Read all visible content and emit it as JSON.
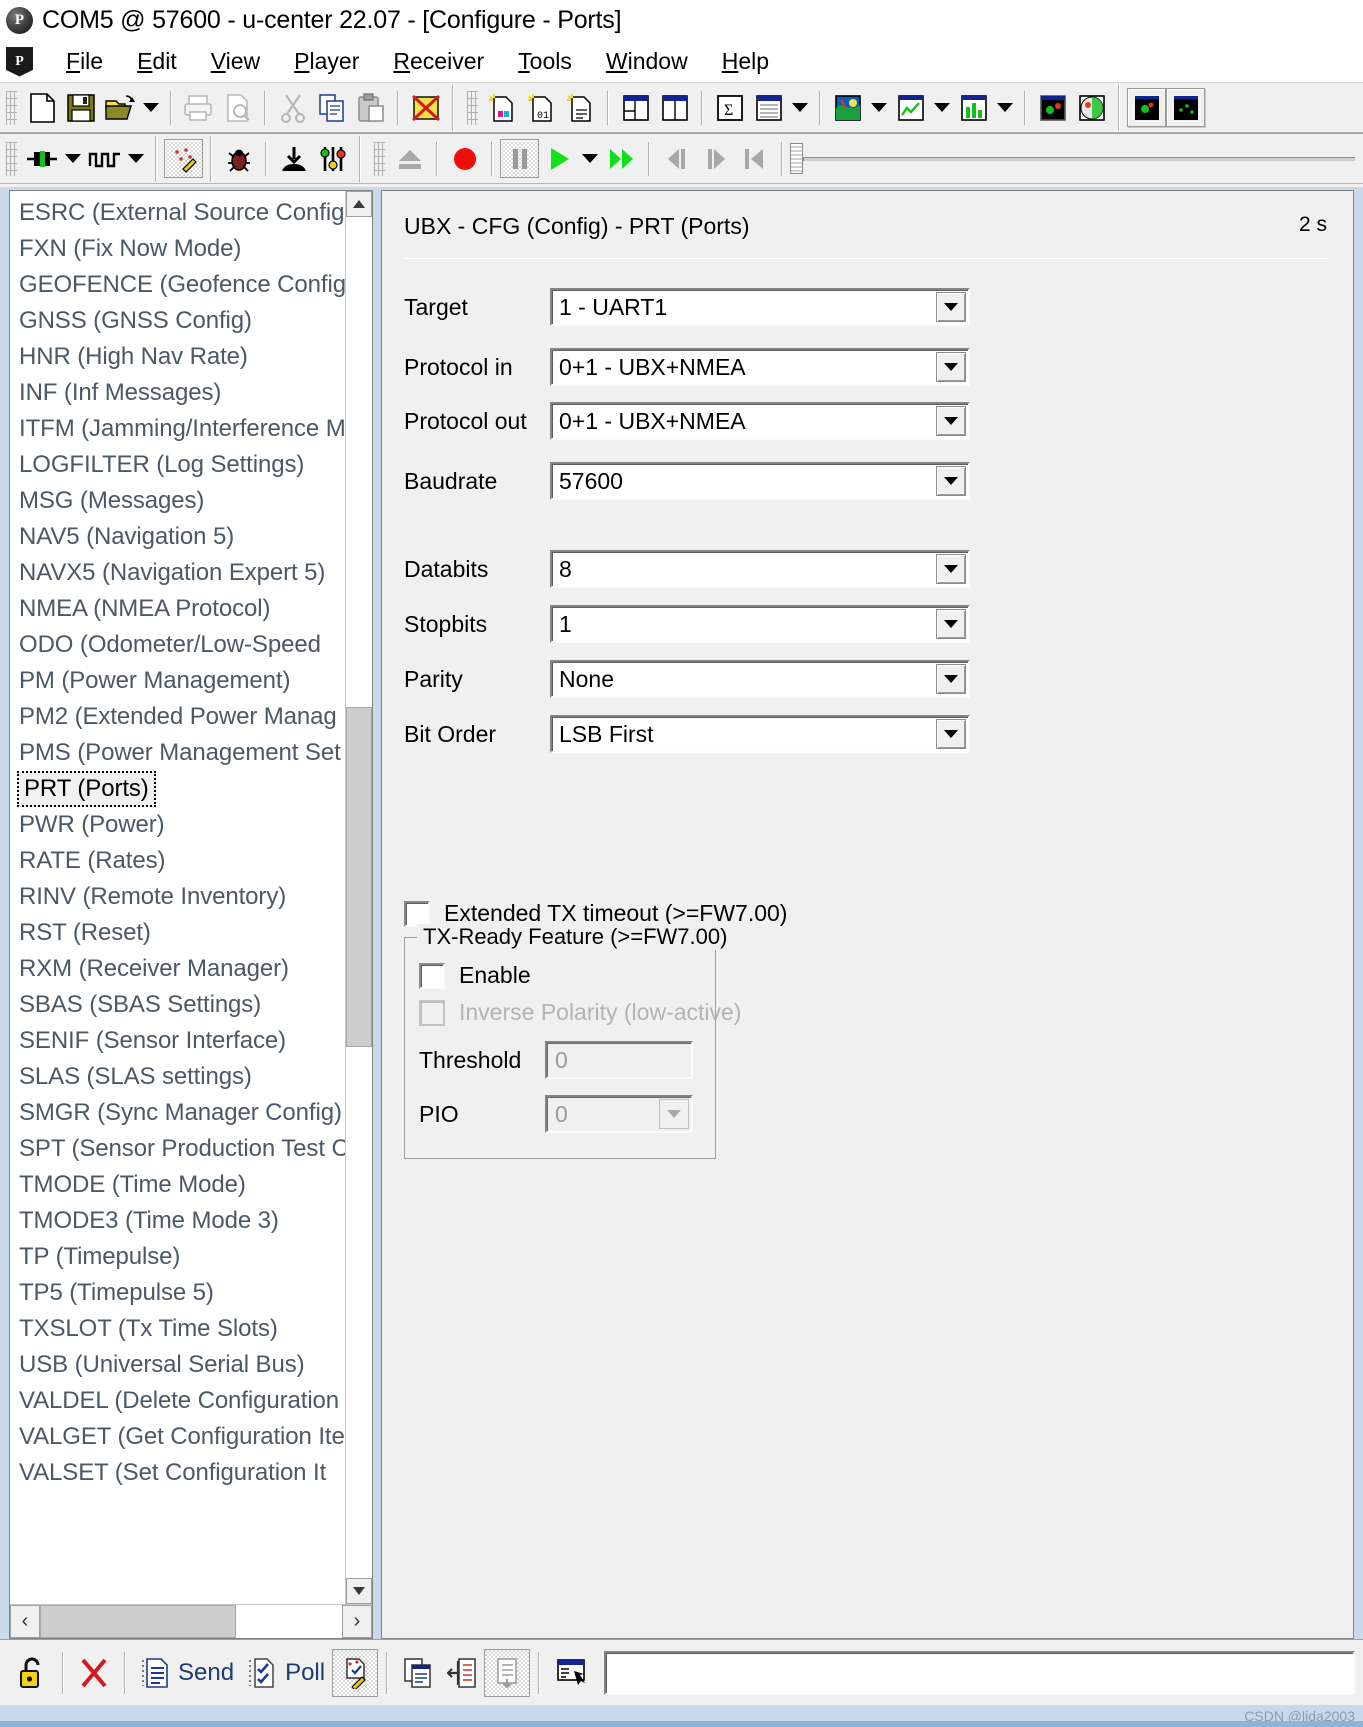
{
  "window": {
    "title": "COM5 @ 57600 - u-center 22.07 - [Configure - Ports]",
    "app_icon": "P"
  },
  "menu": {
    "icon": "P",
    "items": [
      {
        "label": "File",
        "accel": "F"
      },
      {
        "label": "Edit",
        "accel": "E"
      },
      {
        "label": "View",
        "accel": "V"
      },
      {
        "label": "Player",
        "accel": "P"
      },
      {
        "label": "Receiver",
        "accel": "R"
      },
      {
        "label": "Tools",
        "accel": "T"
      },
      {
        "label": "Window",
        "accel": "W"
      },
      {
        "label": "Help",
        "accel": "H"
      }
    ]
  },
  "toolbar_top": [
    {
      "name": "new-file-icon"
    },
    {
      "name": "save-icon"
    },
    {
      "name": "open-folder-icon"
    },
    {
      "name": "open-dropdown-arrow-icon"
    },
    {
      "name": "print-icon"
    },
    {
      "name": "print-preview-icon"
    },
    {
      "name": "cut-icon"
    },
    {
      "name": "copy-icon"
    },
    {
      "name": "paste-icon"
    },
    {
      "name": "delete-red-x-icon"
    },
    {
      "name": "new-config-color-icon"
    },
    {
      "name": "new-config-binary-icon"
    },
    {
      "name": "new-config-text-icon"
    },
    {
      "name": "dock-layout-icon"
    },
    {
      "name": "split-layout-icon"
    },
    {
      "name": "statistic-sigma-icon"
    },
    {
      "name": "table-view-icon"
    },
    {
      "name": "table-dropdown-arrow-icon"
    },
    {
      "name": "map-view-icon"
    },
    {
      "name": "map-dropdown-arrow-icon"
    },
    {
      "name": "chart-line-icon"
    },
    {
      "name": "chart-dropdown-arrow-icon"
    },
    {
      "name": "histogram-icon"
    },
    {
      "name": "histogram-dropdown-arrow-icon"
    },
    {
      "name": "sky-view-icon"
    },
    {
      "name": "sat-level-icon"
    },
    {
      "name": "deviation-map-icon"
    },
    {
      "name": "scatter-plot-icon"
    }
  ],
  "toolbar_second": [
    {
      "name": "connect-port-icon"
    },
    {
      "name": "connect-dropdown-arrow-icon"
    },
    {
      "name": "baudrate-icon"
    },
    {
      "name": "baudrate-dropdown-arrow-icon"
    },
    {
      "name": "message-view-icon"
    },
    {
      "name": "debug-bug-icon"
    },
    {
      "name": "download-icon"
    },
    {
      "name": "config-sliders-icon"
    },
    {
      "name": "eject-icon"
    },
    {
      "name": "record-icon"
    },
    {
      "name": "pause-icon"
    },
    {
      "name": "play-icon"
    },
    {
      "name": "play-dropdown-arrow-icon"
    },
    {
      "name": "fast-forward-icon"
    },
    {
      "name": "step-back-icon"
    },
    {
      "name": "step-forward-icon"
    },
    {
      "name": "rewind-start-icon"
    },
    {
      "name": "player-slider"
    }
  ],
  "sidebar": {
    "items": [
      {
        "label": "ESRC (External Source Config)",
        "selected": false
      },
      {
        "label": "FXN (Fix Now Mode)",
        "selected": false
      },
      {
        "label": "GEOFENCE (Geofence Config)",
        "selected": false
      },
      {
        "label": "GNSS (GNSS Config)",
        "selected": false
      },
      {
        "label": "HNR (High Nav Rate)",
        "selected": false
      },
      {
        "label": "INF (Inf Messages)",
        "selected": false
      },
      {
        "label": "ITFM (Jamming/Interference M",
        "selected": false
      },
      {
        "label": "LOGFILTER (Log Settings)",
        "selected": false
      },
      {
        "label": "MSG (Messages)",
        "selected": false
      },
      {
        "label": "NAV5 (Navigation 5)",
        "selected": false
      },
      {
        "label": "NAVX5 (Navigation Expert 5)",
        "selected": false
      },
      {
        "label": "NMEA (NMEA Protocol)",
        "selected": false
      },
      {
        "label": "ODO (Odometer/Low-Speed",
        "selected": false
      },
      {
        "label": "PM (Power Management)",
        "selected": false
      },
      {
        "label": "PM2 (Extended Power Manag",
        "selected": false
      },
      {
        "label": "PMS (Power Management Set",
        "selected": false
      },
      {
        "label": "PRT (Ports)",
        "selected": true
      },
      {
        "label": "PWR (Power)",
        "selected": false
      },
      {
        "label": "RATE (Rates)",
        "selected": false
      },
      {
        "label": "RINV (Remote Inventory)",
        "selected": false
      },
      {
        "label": "RST (Reset)",
        "selected": false
      },
      {
        "label": "RXM (Receiver Manager)",
        "selected": false
      },
      {
        "label": "SBAS (SBAS Settings)",
        "selected": false
      },
      {
        "label": "SENIF (Sensor Interface)",
        "selected": false
      },
      {
        "label": "SLAS (SLAS settings)",
        "selected": false
      },
      {
        "label": "SMGR (Sync Manager Config)",
        "selected": false
      },
      {
        "label": "SPT (Sensor Production Test C",
        "selected": false
      },
      {
        "label": "TMODE (Time Mode)",
        "selected": false
      },
      {
        "label": "TMODE3 (Time Mode 3)",
        "selected": false
      },
      {
        "label": "TP (Timepulse)",
        "selected": false
      },
      {
        "label": "TP5 (Timepulse 5)",
        "selected": false
      },
      {
        "label": "TXSLOT (Tx Time Slots)",
        "selected": false
      },
      {
        "label": "USB (Universal Serial Bus)",
        "selected": false
      },
      {
        "label": "VALDEL (Delete Configuration",
        "selected": false
      },
      {
        "label": "VALGET (Get Configuration Ite",
        "selected": false
      },
      {
        "label": "VALSET (Set Configuration It",
        "selected": false
      }
    ],
    "scroll_up_icon": "chevron-up-icon",
    "scroll_down_icon": "chevron-down-icon",
    "hscroll_left_icon": "chevron-left-icon",
    "hscroll_right_icon": "chevron-right-icon"
  },
  "panel": {
    "title": "UBX - CFG (Config) - PRT (Ports)",
    "age": "2 s",
    "fields": [
      {
        "label": "Target",
        "value": "1 - UART1"
      },
      {
        "label": "Protocol in",
        "value": "0+1 - UBX+NMEA"
      },
      {
        "label": "Protocol out",
        "value": "0+1 - UBX+NMEA"
      },
      {
        "label": "Baudrate",
        "value": "57600"
      },
      {
        "label": "Databits",
        "value": "8"
      },
      {
        "label": "Stopbits",
        "value": "1"
      },
      {
        "label": "Parity",
        "value": "None"
      },
      {
        "label": "Bit Order",
        "value": "LSB First"
      }
    ],
    "extended_tx_timeout": {
      "label": "Extended TX timeout (>=FW7.00)",
      "checked": false
    },
    "tx_ready": {
      "legend": "TX-Ready Feature (>=FW7.00)",
      "enable": {
        "label": "Enable",
        "checked": false,
        "disabled": false
      },
      "inverse_polarity": {
        "label": "Inverse Polarity (low-active)",
        "checked": false,
        "disabled": true
      },
      "threshold": {
        "label": "Threshold",
        "value": "0",
        "disabled": true
      },
      "pio": {
        "label": "PIO",
        "value": "0",
        "disabled": true
      }
    }
  },
  "actionbar": {
    "buttons": [
      {
        "name": "unlock-icon",
        "label": ""
      },
      {
        "name": "clear-red-x-icon",
        "label": ""
      },
      {
        "name": "send-icon",
        "label": "Send"
      },
      {
        "name": "poll-icon",
        "label": "Poll"
      },
      {
        "name": "config-wand-icon",
        "label": ""
      },
      {
        "name": "copy-config-icon",
        "label": ""
      },
      {
        "name": "import-config-icon",
        "label": ""
      },
      {
        "name": "export-config-icon",
        "label": ""
      },
      {
        "name": "keyboard-entry-icon",
        "label": ""
      }
    ],
    "command_input_value": ""
  },
  "footer": {
    "watermark": "CSDN @lida2003"
  }
}
